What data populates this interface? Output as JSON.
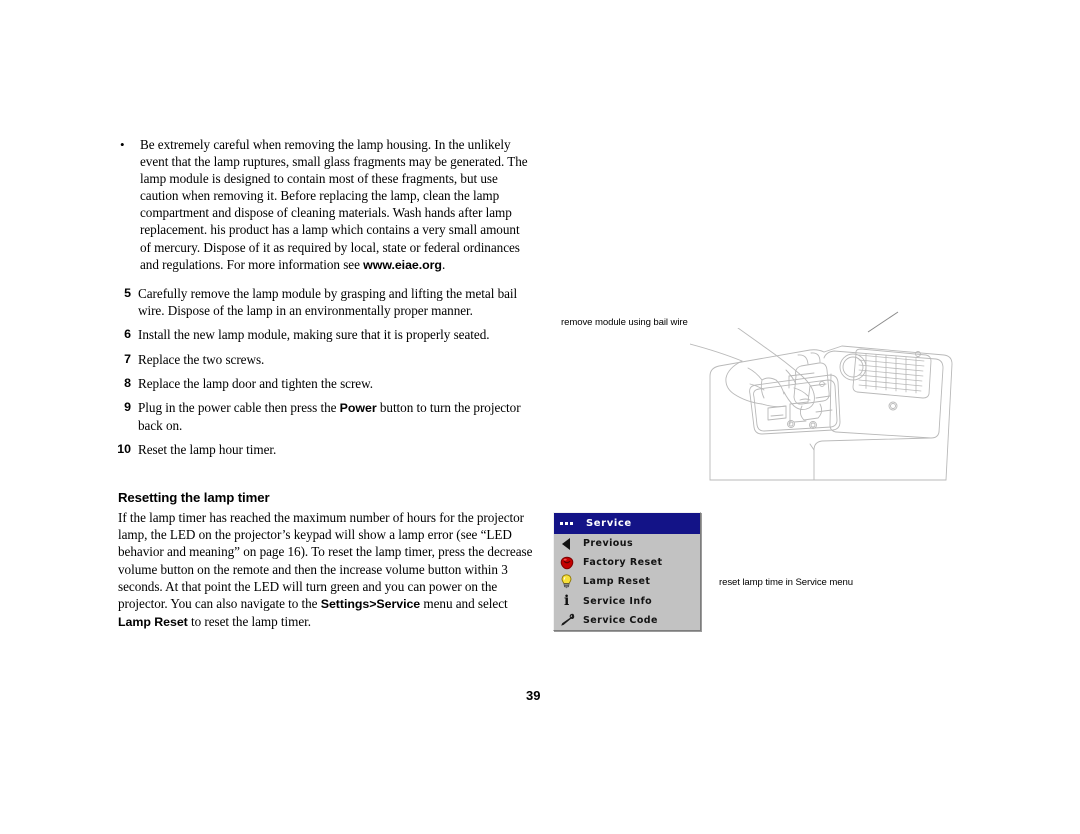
{
  "document": {
    "page_number": "39"
  },
  "warning": {
    "bullet": "•",
    "text_parts": {
      "before": "Be extremely careful when removing the lamp housing. In the unlikely event that the lamp ruptures, small glass fragments may be generated. The lamp module is designed to contain most of these fragments, but use caution when removing it. Before replacing the lamp, clean the lamp compartment and dispose of cleaning materials. Wash hands after lamp replacement. his product has a lamp which contains a very small amount of mercury. Dispose of it as required by local, state or federal ordinances and regulations. For more information see ",
      "bold": "www.eiae.org",
      "after": "."
    }
  },
  "steps": [
    {
      "num": "5",
      "text": "Carefully remove the lamp module by grasping and lifting the metal bail wire. Dispose of the lamp in an environmentally proper manner."
    },
    {
      "num": "6",
      "text": "Install the new lamp module, making sure that it is properly seated."
    },
    {
      "num": "7",
      "text": "Replace the two screws."
    },
    {
      "num": "8",
      "text": "Replace the lamp door and tighten the screw."
    },
    {
      "num": "9",
      "text": "Plug in the power cable then press the ",
      "bold": "Power",
      "text_after": " button to turn the projector back on."
    },
    {
      "num": "10",
      "text": "Reset the lamp hour timer."
    }
  ],
  "section": {
    "heading": "Resetting the lamp timer",
    "body_1": "If the lamp timer has reached the maximum number of hours for the projector lamp, the LED on the projector’s keypad will show a lamp error (see “LED behavior and meaning” on page 16). To reset the lamp timer, press the decrease volume button on the remote and then the increase volume button within 3 seconds. At that point the LED will turn green and you can power on the projector. You can also navigate to the ",
    "bold_1": "Settings>Service",
    "body_2": " menu and select ",
    "bold_2": "Lamp Reset",
    "body_3": " to reset the lamp timer."
  },
  "captions": {
    "module": "remove module using bail wire",
    "reset": "reset lamp time in Service menu"
  },
  "osd": {
    "title": "Service",
    "header_color": "#131387",
    "body_color": "#c2c2c2",
    "items": [
      {
        "label": "Previous",
        "icon": "previous-arrow-icon"
      },
      {
        "label": "Factory Reset",
        "icon": "factory-reset-icon"
      },
      {
        "label": "Lamp Reset",
        "icon": "lightbulb-icon"
      },
      {
        "label": "Service Info",
        "icon": "info-icon"
      },
      {
        "label": "Service Code",
        "icon": "wrench-icon"
      }
    ]
  }
}
